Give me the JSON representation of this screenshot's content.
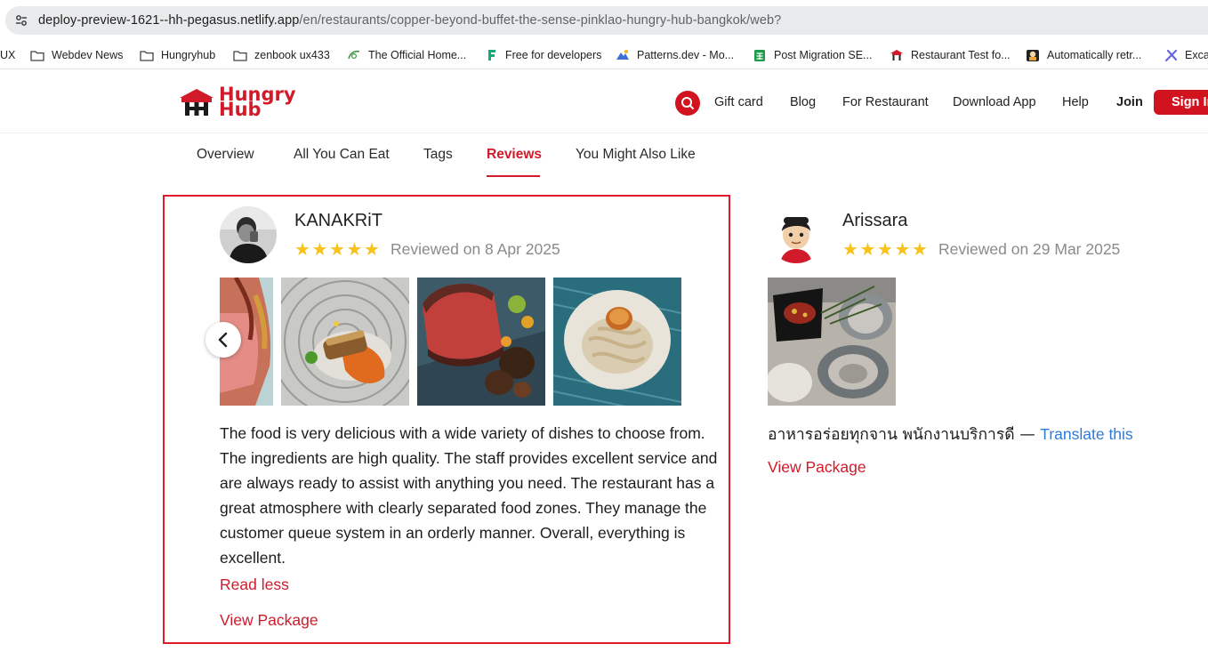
{
  "browser": {
    "url_host": "deploy-preview-1621--hh-pegasus.netlify.app",
    "url_path": "/en/restaurants/copper-beyond-buffet-the-sense-pinklao-hungry-hub-bangkok/web?",
    "bookmarks": [
      {
        "label": "UX",
        "icon": "none"
      },
      {
        "label": "Webdev News",
        "icon": "folder-icon"
      },
      {
        "label": "Hungryhub",
        "icon": "folder-icon"
      },
      {
        "label": "zenbook ux433",
        "icon": "folder-icon"
      },
      {
        "label": "The Official Home...",
        "icon": "site-favicon"
      },
      {
        "label": "Free for developers",
        "icon": "f-favicon"
      },
      {
        "label": "Patterns.dev - Mo...",
        "icon": "patterns-favicon"
      },
      {
        "label": "Post Migration SE...",
        "icon": "sheets-favicon"
      },
      {
        "label": "Restaurant Test fo...",
        "icon": "hungryhub-favicon"
      },
      {
        "label": "Automatically retr...",
        "icon": "bot-favicon"
      },
      {
        "label": "Excal",
        "icon": "excalidraw-favicon"
      }
    ]
  },
  "header": {
    "logo_line1": "Hungry",
    "logo_line2": "Hub",
    "nav": {
      "gift_card": "Gift card",
      "blog": "Blog",
      "for_restaurant": "For Restaurant",
      "download_app": "Download App",
      "help": "Help",
      "join": "Join",
      "sign_in": "Sign In"
    }
  },
  "tabs": [
    {
      "label": "Overview",
      "active": false
    },
    {
      "label": "All You Can Eat",
      "active": false
    },
    {
      "label": "Tags",
      "active": false
    },
    {
      "label": "Reviews",
      "active": true
    },
    {
      "label": "You Might Also Like",
      "active": false
    }
  ],
  "reviews": [
    {
      "name": "KANAKRiT",
      "rating": 5,
      "date": "Reviewed on 8 Apr 2025",
      "photos": [
        "steak-photo",
        "fish-photo",
        "wagyu-photo",
        "scallop-pasta-photo"
      ],
      "text": "The food is very delicious with a wide variety of dishes to choose from. The ingredients are high quality. The staff provides excellent service and are always ready to assist with anything you need. The restaurant has a great atmosphere with clearly separated food zones. They manage the customer queue system in an orderly manner. Overall, everything is excellent.",
      "read_less": "Read less",
      "view_package": "View Package"
    },
    {
      "name": "Arissara",
      "rating": 5,
      "date": "Reviewed on 29 Mar 2025",
      "photos": [
        "oyster-photo"
      ],
      "text": "อาหารอร่อยทุกจาน พนักงานบริการดี",
      "separator": " — ",
      "translate": "Translate this",
      "view_package": "View Package"
    }
  ],
  "colors": {
    "brand_red": "#d11a2a",
    "star": "#f7c21b",
    "link_blue": "#2e7bd6",
    "highlight_border": "#e0192b"
  }
}
